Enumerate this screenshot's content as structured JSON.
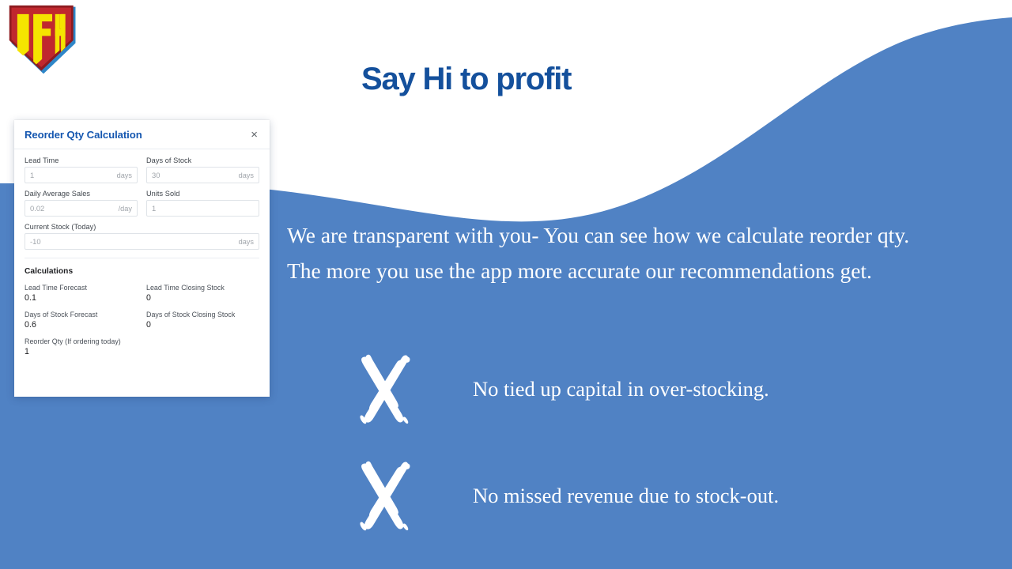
{
  "brand": {
    "logo_text": "IFH",
    "logo_icon": "shield-logo-icon",
    "colors": {
      "shield_yellow": "#F5E400",
      "shield_red": "#A61C22",
      "shield_blue": "#2E86C8"
    }
  },
  "theme": {
    "background_blue": "#5082C4",
    "background_white": "#FFFFFF",
    "headline_blue": "#14509C",
    "modal_title_blue": "#1557B0"
  },
  "headline": {
    "text": "Say Hi to profit"
  },
  "paragraph": {
    "text": "We are transparent with you- You can see how we calculate reorder qty. The more you use the app more accurate our recommendations get."
  },
  "bullets": [
    {
      "icon": "x-brush-mark-icon",
      "text": "No tied up capital in over-stocking."
    },
    {
      "icon": "x-brush-mark-icon",
      "text": "No missed revenue due to stock-out."
    }
  ],
  "modal": {
    "title": "Reorder Qty Calculation",
    "close_label": "×",
    "close_icon": "close-icon",
    "fields": [
      {
        "label": "Lead Time",
        "value": "1",
        "unit": "days"
      },
      {
        "label": "Days of Stock",
        "value": "30",
        "unit": "days"
      },
      {
        "label": "Daily Average Sales",
        "value": "0.02",
        "unit": "/day"
      },
      {
        "label": "Units Sold",
        "value": "1",
        "unit": ""
      },
      {
        "label": "Current Stock (Today)",
        "value": "-10",
        "unit": "days"
      }
    ],
    "calculations_title": "Calculations",
    "calculations": [
      {
        "label": "Lead Time Forecast",
        "value": "0.1"
      },
      {
        "label": "Lead Time Closing Stock",
        "value": "0"
      },
      {
        "label": "Days of Stock Forecast",
        "value": "0.6"
      },
      {
        "label": "Days of Stock Closing Stock",
        "value": "0"
      },
      {
        "label": "Reorder Qty (If ordering today)",
        "value": "1"
      }
    ]
  }
}
